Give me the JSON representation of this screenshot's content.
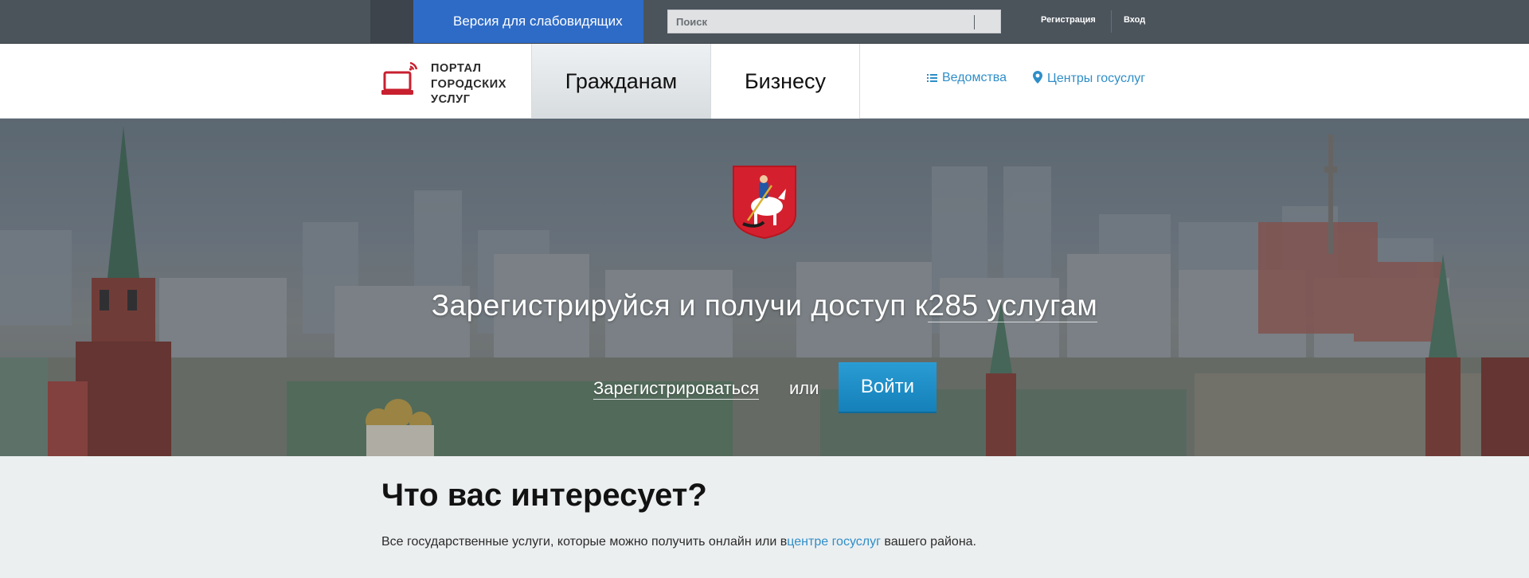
{
  "topbar": {
    "vision_label": "Версия для слабовидящих",
    "search_placeholder": "Поиск",
    "register_label": "Регистрация",
    "login_label": "Вход"
  },
  "navbar": {
    "logo_lines": [
      "ПОРТАЛ",
      "ГОРОДСКИХ",
      "УСЛУГ"
    ],
    "tabs": [
      {
        "label": "Гражданам",
        "active": true
      },
      {
        "label": "Бизнесу",
        "active": false
      }
    ],
    "departments_label": "Ведомства",
    "centers_label": "Центры госуслуг"
  },
  "hero": {
    "headline_prefix": "Зарегистрируйся и получи доступ к",
    "headline_link": "285 услугам",
    "register_label": "Зарегистрироваться",
    "or_label": "или",
    "login_label": "Войти"
  },
  "interest": {
    "title": "Что вас интересует?",
    "desc_prefix": "Все государственные услуги, которые можно получить онлайн или в",
    "desc_link": "центре госуслуг",
    "desc_suffix": " вашего района."
  },
  "colors": {
    "topbar_bg": "#4b535b",
    "vision_button": "#2e6bc6",
    "accent_link": "#2f8ec8",
    "login_button": "#1f8fc7",
    "logo_red": "#c8202f"
  },
  "icons": [
    "laptop-wifi-logo-icon",
    "list-icon",
    "map-pin-icon",
    "moscow-coat-of-arms-icon"
  ]
}
